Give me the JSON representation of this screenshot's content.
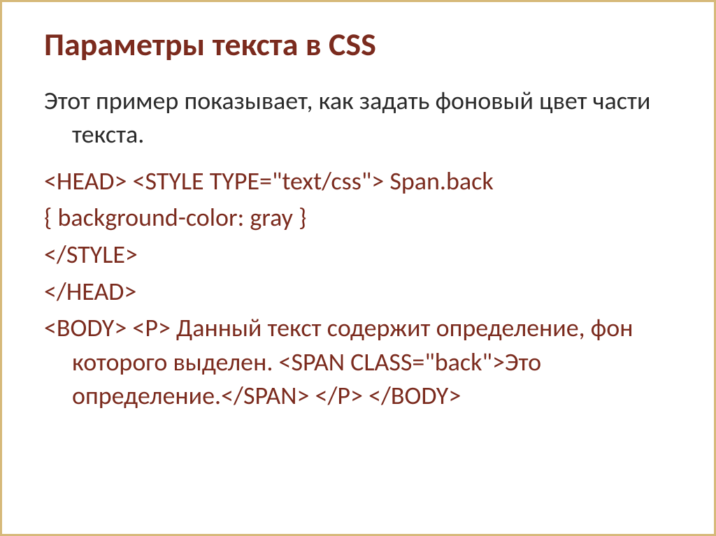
{
  "title": "Параметры текста в CSS",
  "intro": "Этот пример показывает, как задать фоновый цвет части текста.",
  "code": {
    "line1": "<HEAD> <STYLE TYPE=\"text/css\"> Span.back",
    "line2": "{ background-color: gray }",
    "line3": "</STYLE>",
    "line4": "</HEAD>",
    "line5": "<BODY> <P> Данный текст содержит определение, фон которого выделен. <SPAN CLASS=\"back\">Это определение.</SPAN> </P> </BODY>"
  }
}
